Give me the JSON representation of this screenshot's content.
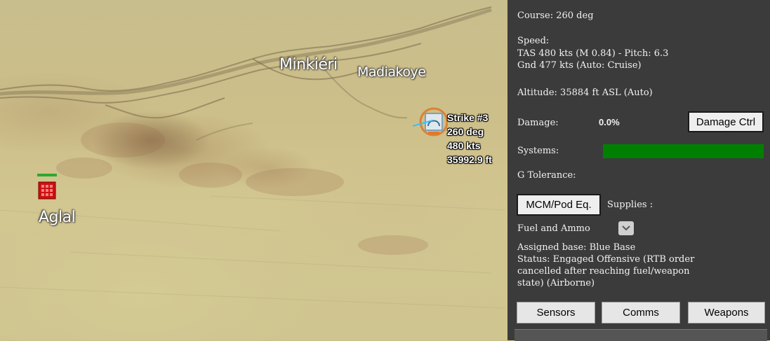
{
  "map": {
    "places": [
      {
        "name": "Minkiéri"
      },
      {
        "name": "Madiakoye"
      },
      {
        "name": "Aglal"
      }
    ],
    "unit": {
      "name": "Strike #3",
      "heading": "260 deg",
      "speed": "480 kts",
      "altitude": "35992.9 ft",
      "icon": "aircraft-icon",
      "highlight_color": "#e07a2a"
    },
    "base_icon": "airbase-icon",
    "base_color": "#cc1111"
  },
  "panel": {
    "course": "Course: 260 deg",
    "speed_title": "Speed:",
    "speed_tas": "TAS 480 kts (M 0.84) - Pitch: 6.3",
    "speed_gnd": "Gnd 477 kts (Auto: Cruise)",
    "altitude": "Altitude: 35884 ft ASL (Auto)",
    "damage_label": "Damage:",
    "damage_value": "0.0%",
    "damage_ctrl_button": "Damage Ctrl",
    "systems_label": "Systems:",
    "systems_health": 1.0,
    "systems_color": "#008000",
    "g_tolerance_label": "G Tolerance:",
    "mcm_button": "MCM/Pod Eq.",
    "supplies_label": "Supplies :",
    "supplies_select": "Fuel and Ammo",
    "assigned_base": "Assigned base: Blue Base",
    "status_lines": [
      "Status: Engaged Offensive (RTB order",
      "cancelled after reaching fuel/weapon",
      "state) (Airborne)"
    ],
    "buttons": {
      "sensors": "Sensors",
      "comms": "Comms",
      "weapons": "Weapons"
    }
  }
}
